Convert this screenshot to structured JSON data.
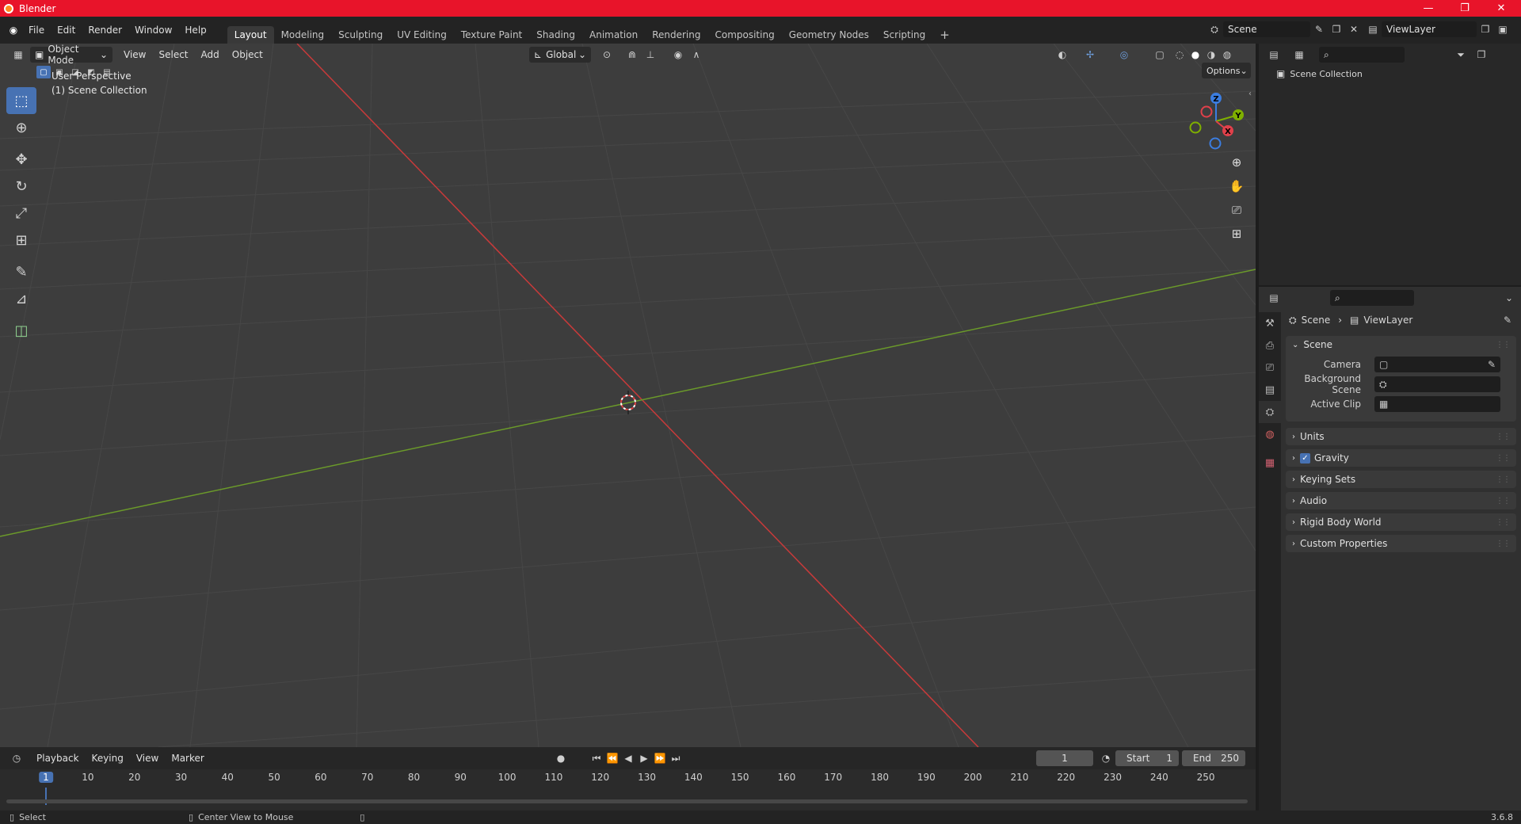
{
  "window": {
    "title": "Blender",
    "minimize": "—",
    "restore": "❐",
    "close": "✕"
  },
  "menubar": {
    "items": [
      "File",
      "Edit",
      "Render",
      "Window",
      "Help"
    ]
  },
  "workspaces": {
    "tabs": [
      "Layout",
      "Modeling",
      "Sculpting",
      "UV Editing",
      "Texture Paint",
      "Shading",
      "Animation",
      "Rendering",
      "Compositing",
      "Geometry Nodes",
      "Scripting"
    ],
    "active": "Layout",
    "add": "+"
  },
  "scene_selector": {
    "value": "Scene"
  },
  "viewlayer_selector": {
    "value": "ViewLayer"
  },
  "viewport": {
    "mode": "Object Mode",
    "menus": [
      "View",
      "Select",
      "Add",
      "Object"
    ],
    "orientation": "Global",
    "options_label": "Options",
    "perspective_label": "User Perspective",
    "collection_label": "(1) Scene Collection",
    "gizmo": {
      "x": "X",
      "y": "Y",
      "z": "Z"
    }
  },
  "outliner": {
    "root": "Scene Collection"
  },
  "properties": {
    "breadcrumb": [
      "Scene",
      "ViewLayer"
    ],
    "scene_panel": {
      "title": "Scene",
      "fields": [
        {
          "label": "Camera",
          "value": ""
        },
        {
          "label": "Background Scene",
          "value": ""
        },
        {
          "label": "Active Clip",
          "value": ""
        }
      ]
    },
    "collapsed_panels": [
      {
        "title": "Units",
        "checkbox": false
      },
      {
        "title": "Gravity",
        "checkbox": true
      },
      {
        "title": "Keying Sets",
        "checkbox": false
      },
      {
        "title": "Audio",
        "checkbox": false
      },
      {
        "title": "Rigid Body World",
        "checkbox": false
      },
      {
        "title": "Custom Properties",
        "checkbox": false
      }
    ]
  },
  "timeline": {
    "menus": [
      "Playback",
      "Keying",
      "View",
      "Marker"
    ],
    "current_frame": "1",
    "start_label": "Start",
    "start_value": "1",
    "end_label": "End",
    "end_value": "250",
    "ticks": [
      "1",
      "10",
      "20",
      "30",
      "40",
      "50",
      "60",
      "70",
      "80",
      "90",
      "100",
      "110",
      "120",
      "130",
      "140",
      "150",
      "160",
      "170",
      "180",
      "190",
      "200",
      "210",
      "220",
      "230",
      "240",
      "250"
    ]
  },
  "statusbar": {
    "left_action": "Select",
    "middle_action": "Center View to Mouse",
    "version": "3.6.8"
  },
  "colors": {
    "accent": "#4772b3",
    "titlebar": "#e8142a",
    "x_axis": "#c93a3a",
    "y_axis": "#6b9a2a"
  }
}
